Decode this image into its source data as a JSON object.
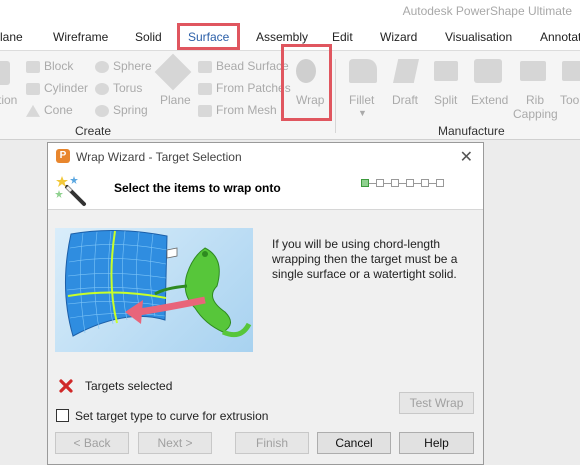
{
  "app_title": "Autodesk PowerShape Ultimate",
  "tabs": [
    {
      "label": "lane"
    },
    {
      "label": "Wireframe"
    },
    {
      "label": "Solid"
    },
    {
      "label": "Surface"
    },
    {
      "label": "Assembly"
    },
    {
      "label": "Edit"
    },
    {
      "label": "Wizard"
    },
    {
      "label": "Visualisation"
    },
    {
      "label": "Annotat"
    }
  ],
  "ribbon": {
    "create_items": {
      "tion": "tion",
      "block": "Block",
      "cylinder": "Cylinder",
      "cone": "Cone",
      "sphere": "Sphere",
      "torus": "Torus",
      "spring": "Spring",
      "plane": "Plane",
      "bead_surface": "Bead Surface",
      "from_patches": "From Patches",
      "from_mesh": "From Mesh",
      "wrap": "Wrap"
    },
    "manufacture_items": {
      "fillet": "Fillet",
      "draft": "Draft",
      "split": "Split",
      "extend": "Extend",
      "rib": "Rib",
      "capping": "Capping",
      "too": "Too"
    },
    "group_create": "Create",
    "group_manufacture": "Manufacture"
  },
  "dialog": {
    "title": "Wrap Wizard - Target Selection",
    "app_icon_letter": "P",
    "close_glyph": "✕",
    "heading": "Select the items to wrap onto",
    "description": "If you will be using chord-length wrapping then the target must be a single surface or a watertight solid.",
    "step_progress": {
      "current": 1,
      "total": 6
    },
    "status_text": "Targets selected",
    "test_wrap": "Test Wrap",
    "checkbox_label": "Set target type to curve for extrusion",
    "checkbox_checked": false,
    "back": "< Back",
    "next": "Next >",
    "finish": "Finish",
    "cancel": "Cancel",
    "help": "Help"
  },
  "colors": {
    "highlight": "#e0565f",
    "accent": "#2b5fa8",
    "error": "#d02828"
  },
  "icons": [
    "wand-icon",
    "x-mark-icon",
    "close-icon",
    "app-logo-icon"
  ]
}
